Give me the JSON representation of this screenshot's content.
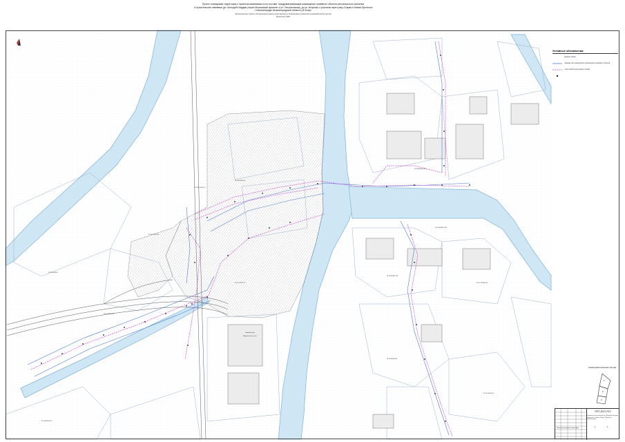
{
  "title": {
    "main": "Проект планировки территории с проектом межевания в его составе, предусматривающий размещение линейного объекта регионального значения «Строительство ливневки  (ул. Молодой Гвардии (через Московский проспект к ул. Ольштынская), до ул. Игорная) с участком через реку Старая и Новая Преголя в г. Калининграде Калининградской области (III этап)»",
    "subtitle": "Чертеж красных линий с обозначением границ существующих и планируемых элементов планировочной структуры",
    "scale": "Масштаб 1:2000"
  },
  "legend": {
    "heading": "Условные обозначения:",
    "items": [
      {
        "symbol": "line-blue",
        "text": "красные линии"
      },
      {
        "symbol": "line-magenta",
        "text": "границы зон планируемого размещения линейного объекта"
      },
      {
        "symbol": "point-black",
        "text": "точки поворотных красных линий"
      }
    ]
  },
  "map_labels": {
    "plant": "Газовый завод",
    "plant_sub": "Промышленная зона"
  },
  "parcels": [
    "39:15:000000:1",
    "39:15:131017:88",
    "39:15:131016:15",
    "39:15:000000:73",
    "39:15:131017:54",
    "39:15:131017:52",
    "39:15:000000:1112",
    "39:15:000000:104",
    "39:15:000000:128",
    "39:15:131004:107",
    "39:15:000000:44",
    "39:15:131004:64",
    "39:15:000000:22"
  ],
  "scheme": {
    "heading": "Схема расположения листов",
    "sheets": [
      "1",
      "2",
      "3"
    ]
  },
  "stamp": {
    "code": "ППТ-2017-ЛТ2",
    "description": "Строительство ливневки  (ул. Молодой Гвардии) через реку Старая и Новая Преголя в г. Калининграде",
    "document": "Проект планировки территории",
    "stage": "ППТ",
    "sheet": "1",
    "sheets": "3"
  },
  "colors": {
    "river": "#cfe6f5",
    "river_edge": "#7fb0d6",
    "red_line": "#4a7bd1",
    "zone_line": "#d04bd0",
    "hatch": "#9a9a9a",
    "parcel": "#8fa7c9"
  }
}
